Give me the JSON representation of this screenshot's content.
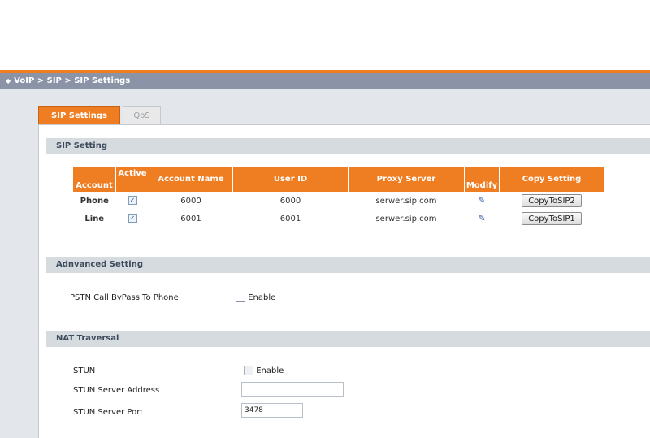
{
  "breadcrumb": "VoIP > SIP > SIP Settings",
  "tabs": [
    {
      "label": "SIP Settings",
      "active": true
    },
    {
      "label": "QoS",
      "active": false
    }
  ],
  "sections": {
    "sip_setting": "SIP Setting",
    "advanced_setting": "Adnvanced Setting",
    "nat_traversal": "NAT Traversal"
  },
  "accounts_table": {
    "headers": [
      "Account",
      "Active",
      "Account Name",
      "User ID",
      "Proxy Server",
      "Modify",
      "Copy Setting"
    ],
    "rows": [
      {
        "account": "Phone",
        "active": true,
        "account_name": "6000",
        "user_id": "6000",
        "proxy_server": "serwer.sip.com",
        "copy_button": "CopyToSIP2"
      },
      {
        "account": "Line",
        "active": true,
        "account_name": "6001",
        "user_id": "6001",
        "proxy_server": "serwer.sip.com",
        "copy_button": "CopyToSIP1"
      }
    ]
  },
  "advanced": {
    "pstn_label": "PSTN Call ByPass To Phone",
    "pstn_enable_label": "Enable",
    "pstn_enabled": false
  },
  "nat": {
    "stun_label": "STUN",
    "stun_enable_label": "Enable",
    "stun_enabled": false,
    "server_address_label": "STUN Server Address",
    "server_address_value": "",
    "server_port_label": "STUN Server Port",
    "server_port_value": "3478"
  },
  "colors": {
    "accent": "#ef7d21",
    "breadcrumb_bg": "#8a94a6",
    "section_bg": "#d6dbe0",
    "page_bg": "#e3e7ec"
  },
  "icons": {
    "modify": "edit-pencil-icon",
    "breadcrumb": "bullet-icon"
  }
}
